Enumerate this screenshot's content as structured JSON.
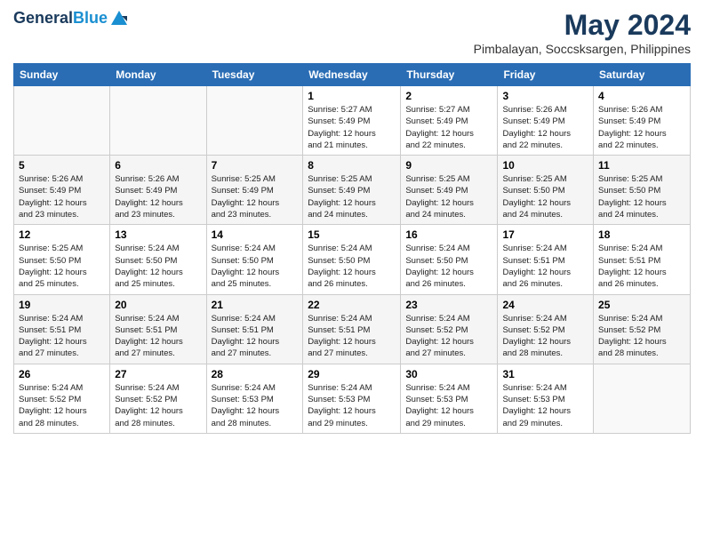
{
  "header": {
    "monthYear": "May 2024",
    "location": "Pimbalayan, Soccsksargen, Philippines"
  },
  "columns": [
    "Sunday",
    "Monday",
    "Tuesday",
    "Wednesday",
    "Thursday",
    "Friday",
    "Saturday"
  ],
  "weeks": [
    [
      {
        "day": "",
        "info": ""
      },
      {
        "day": "",
        "info": ""
      },
      {
        "day": "",
        "info": ""
      },
      {
        "day": "1",
        "info": "Sunrise: 5:27 AM\nSunset: 5:49 PM\nDaylight: 12 hours\nand 21 minutes."
      },
      {
        "day": "2",
        "info": "Sunrise: 5:27 AM\nSunset: 5:49 PM\nDaylight: 12 hours\nand 22 minutes."
      },
      {
        "day": "3",
        "info": "Sunrise: 5:26 AM\nSunset: 5:49 PM\nDaylight: 12 hours\nand 22 minutes."
      },
      {
        "day": "4",
        "info": "Sunrise: 5:26 AM\nSunset: 5:49 PM\nDaylight: 12 hours\nand 22 minutes."
      }
    ],
    [
      {
        "day": "5",
        "info": "Sunrise: 5:26 AM\nSunset: 5:49 PM\nDaylight: 12 hours\nand 23 minutes."
      },
      {
        "day": "6",
        "info": "Sunrise: 5:26 AM\nSunset: 5:49 PM\nDaylight: 12 hours\nand 23 minutes."
      },
      {
        "day": "7",
        "info": "Sunrise: 5:25 AM\nSunset: 5:49 PM\nDaylight: 12 hours\nand 23 minutes."
      },
      {
        "day": "8",
        "info": "Sunrise: 5:25 AM\nSunset: 5:49 PM\nDaylight: 12 hours\nand 24 minutes."
      },
      {
        "day": "9",
        "info": "Sunrise: 5:25 AM\nSunset: 5:49 PM\nDaylight: 12 hours\nand 24 minutes."
      },
      {
        "day": "10",
        "info": "Sunrise: 5:25 AM\nSunset: 5:50 PM\nDaylight: 12 hours\nand 24 minutes."
      },
      {
        "day": "11",
        "info": "Sunrise: 5:25 AM\nSunset: 5:50 PM\nDaylight: 12 hours\nand 24 minutes."
      }
    ],
    [
      {
        "day": "12",
        "info": "Sunrise: 5:25 AM\nSunset: 5:50 PM\nDaylight: 12 hours\nand 25 minutes."
      },
      {
        "day": "13",
        "info": "Sunrise: 5:24 AM\nSunset: 5:50 PM\nDaylight: 12 hours\nand 25 minutes."
      },
      {
        "day": "14",
        "info": "Sunrise: 5:24 AM\nSunset: 5:50 PM\nDaylight: 12 hours\nand 25 minutes."
      },
      {
        "day": "15",
        "info": "Sunrise: 5:24 AM\nSunset: 5:50 PM\nDaylight: 12 hours\nand 26 minutes."
      },
      {
        "day": "16",
        "info": "Sunrise: 5:24 AM\nSunset: 5:50 PM\nDaylight: 12 hours\nand 26 minutes."
      },
      {
        "day": "17",
        "info": "Sunrise: 5:24 AM\nSunset: 5:51 PM\nDaylight: 12 hours\nand 26 minutes."
      },
      {
        "day": "18",
        "info": "Sunrise: 5:24 AM\nSunset: 5:51 PM\nDaylight: 12 hours\nand 26 minutes."
      }
    ],
    [
      {
        "day": "19",
        "info": "Sunrise: 5:24 AM\nSunset: 5:51 PM\nDaylight: 12 hours\nand 27 minutes."
      },
      {
        "day": "20",
        "info": "Sunrise: 5:24 AM\nSunset: 5:51 PM\nDaylight: 12 hours\nand 27 minutes."
      },
      {
        "day": "21",
        "info": "Sunrise: 5:24 AM\nSunset: 5:51 PM\nDaylight: 12 hours\nand 27 minutes."
      },
      {
        "day": "22",
        "info": "Sunrise: 5:24 AM\nSunset: 5:51 PM\nDaylight: 12 hours\nand 27 minutes."
      },
      {
        "day": "23",
        "info": "Sunrise: 5:24 AM\nSunset: 5:52 PM\nDaylight: 12 hours\nand 27 minutes."
      },
      {
        "day": "24",
        "info": "Sunrise: 5:24 AM\nSunset: 5:52 PM\nDaylight: 12 hours\nand 28 minutes."
      },
      {
        "day": "25",
        "info": "Sunrise: 5:24 AM\nSunset: 5:52 PM\nDaylight: 12 hours\nand 28 minutes."
      }
    ],
    [
      {
        "day": "26",
        "info": "Sunrise: 5:24 AM\nSunset: 5:52 PM\nDaylight: 12 hours\nand 28 minutes."
      },
      {
        "day": "27",
        "info": "Sunrise: 5:24 AM\nSunset: 5:52 PM\nDaylight: 12 hours\nand 28 minutes."
      },
      {
        "day": "28",
        "info": "Sunrise: 5:24 AM\nSunset: 5:53 PM\nDaylight: 12 hours\nand 28 minutes."
      },
      {
        "day": "29",
        "info": "Sunrise: 5:24 AM\nSunset: 5:53 PM\nDaylight: 12 hours\nand 29 minutes."
      },
      {
        "day": "30",
        "info": "Sunrise: 5:24 AM\nSunset: 5:53 PM\nDaylight: 12 hours\nand 29 minutes."
      },
      {
        "day": "31",
        "info": "Sunrise: 5:24 AM\nSunset: 5:53 PM\nDaylight: 12 hours\nand 29 minutes."
      },
      {
        "day": "",
        "info": ""
      }
    ]
  ]
}
